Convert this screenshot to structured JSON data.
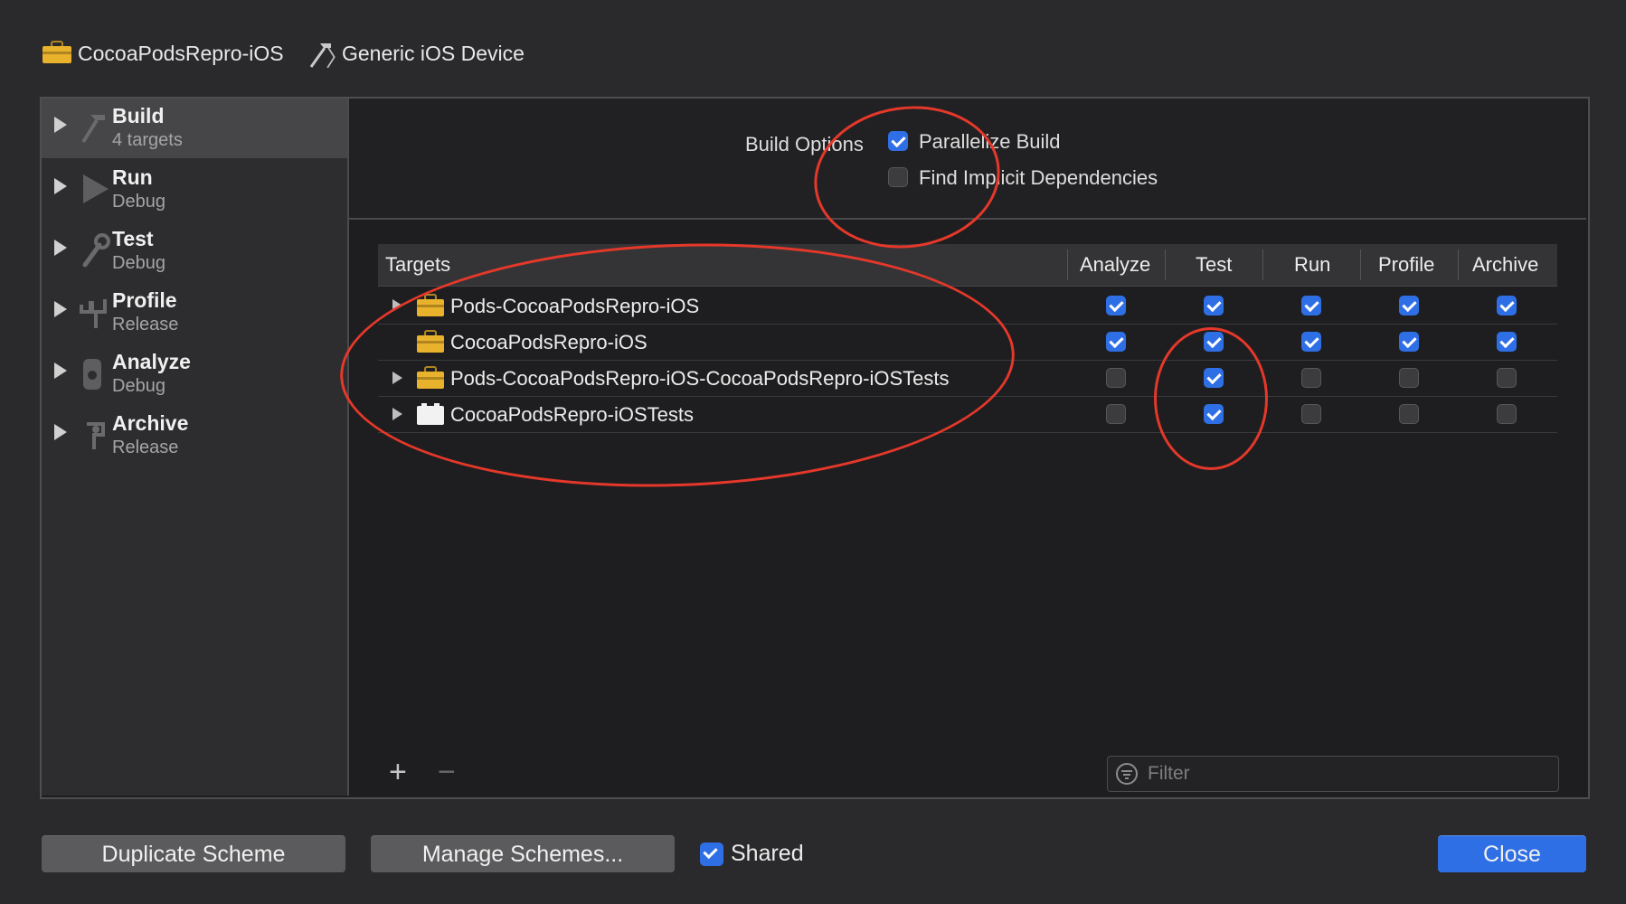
{
  "breadcrumb": {
    "project": "CocoaPodsRepro-iOS",
    "separator": "〉",
    "destination": "Generic iOS Device"
  },
  "sidebar": {
    "items": [
      {
        "title": "Build",
        "subtitle": "4 targets",
        "icon": "hammer-icon",
        "selected": true
      },
      {
        "title": "Run",
        "subtitle": "Debug",
        "icon": "play-icon",
        "selected": false
      },
      {
        "title": "Test",
        "subtitle": "Debug",
        "icon": "wrench-icon",
        "selected": false
      },
      {
        "title": "Profile",
        "subtitle": "Release",
        "icon": "tuning-fork-icon",
        "selected": false
      },
      {
        "title": "Analyze",
        "subtitle": "Debug",
        "icon": "analyze-icon",
        "selected": false
      },
      {
        "title": "Archive",
        "subtitle": "Release",
        "icon": "archive-icon",
        "selected": false
      }
    ]
  },
  "build_options": {
    "label": "Build Options",
    "parallelize": {
      "label": "Parallelize Build",
      "checked": true
    },
    "implicit": {
      "label": "Find Implicit Dependencies",
      "checked": false
    }
  },
  "table": {
    "columns": {
      "targets": "Targets",
      "analyze": "Analyze",
      "test": "Test",
      "run": "Run",
      "profile": "Profile",
      "archive": "Archive"
    },
    "rows": [
      {
        "name": "Pods-CocoaPodsRepro-iOS",
        "expandable": true,
        "icon": "toolbox-icon",
        "analyze": true,
        "test": true,
        "run": true,
        "profile": true,
        "archive": true
      },
      {
        "name": "CocoaPodsRepro-iOS",
        "expandable": false,
        "icon": "toolbox-icon",
        "analyze": true,
        "test": true,
        "run": true,
        "profile": true,
        "archive": true
      },
      {
        "name": "Pods-CocoaPodsRepro-iOS-CocoaPodsRepro-iOSTests",
        "expandable": true,
        "icon": "toolbox-icon",
        "analyze": false,
        "test": true,
        "run": false,
        "profile": false,
        "archive": false
      },
      {
        "name": "CocoaPodsRepro-iOSTests",
        "expandable": true,
        "icon": "test-bundle-icon",
        "analyze": false,
        "test": true,
        "run": false,
        "profile": false,
        "archive": false
      }
    ]
  },
  "toolbar": {
    "add": "+",
    "remove": "−"
  },
  "filter": {
    "placeholder": "Filter"
  },
  "footer": {
    "duplicate": "Duplicate Scheme",
    "manage": "Manage Schemes...",
    "shared": {
      "label": "Shared",
      "checked": true
    },
    "close": "Close"
  },
  "colors": {
    "accent": "#2f6fe5",
    "annotation": "#e5382a",
    "toolbox": "#e9b22c"
  }
}
